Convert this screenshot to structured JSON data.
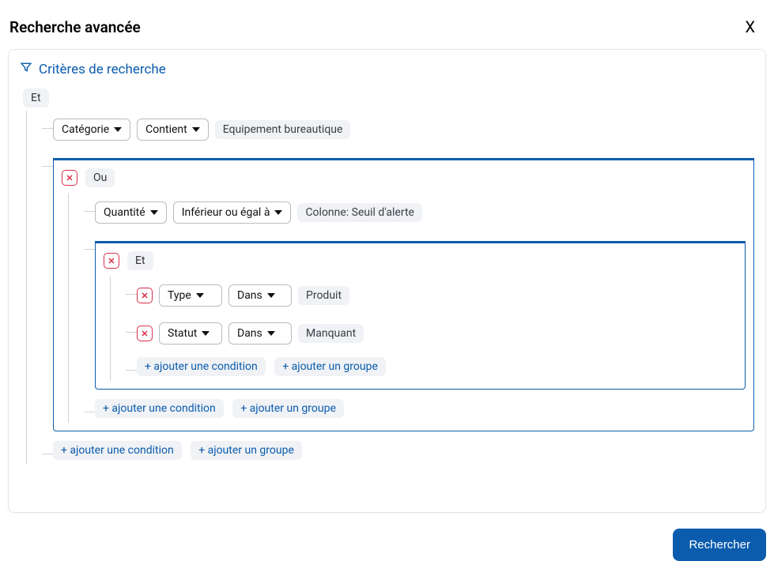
{
  "header": {
    "title": "Recherche avancée",
    "close_label": "X"
  },
  "panel": {
    "heading": "Critères de recherche"
  },
  "root": {
    "op": "Et",
    "rule1": {
      "field": "Catégorie",
      "operator": "Contient",
      "value": "Equipement bureautique"
    },
    "group_ou": {
      "op": "Ou",
      "rule1": {
        "field": "Quantité",
        "operator": "Inférieur ou égal à",
        "value": "Colonne: Seuil d'alerte"
      },
      "group_et": {
        "op": "Et",
        "rule1": {
          "field": "Type",
          "operator": "Dans",
          "value": "Produit"
        },
        "rule2": {
          "field": "Statut",
          "operator": "Dans",
          "value": "Manquant"
        },
        "add_condition": "+ ajouter une condition",
        "add_group": "+ ajouter un groupe"
      },
      "add_condition": "+ ajouter une condition",
      "add_group": "+ ajouter un groupe"
    },
    "add_condition": "+ ajouter une condition",
    "add_group": "+ ajouter un groupe"
  },
  "search_label": "Rechercher"
}
